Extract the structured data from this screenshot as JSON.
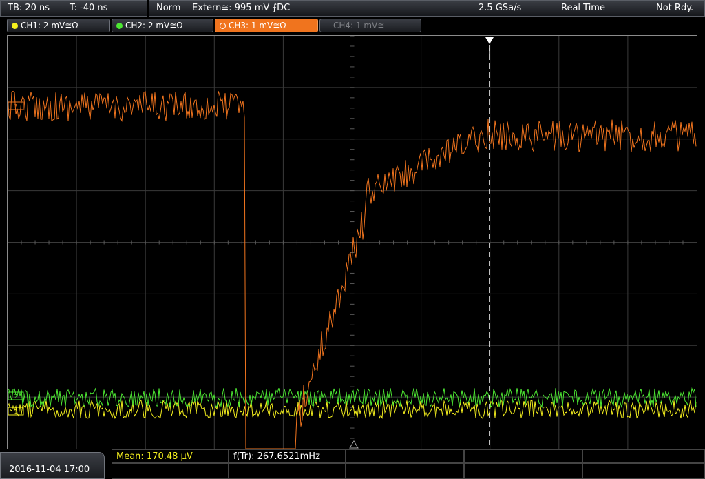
{
  "topbar": {
    "timebase": "TB: 20 ns",
    "trigger_time": "T: -40 ns",
    "trigger_mode": "Norm",
    "trigger_source": "Extern≅: 995 mV ⨍DC",
    "sample_rate": "2.5 GSa/s",
    "acq_mode": "Real Time",
    "status": "Not Rdy."
  },
  "channels": [
    {
      "label": "CH1: 2 mV≅Ω",
      "color": "#f5f01e"
    },
    {
      "label": "CH2: 2 mV≅Ω",
      "color": "#4ce632"
    },
    {
      "label": "CH3: 1 mV≅Ω",
      "color": "#f0741e"
    },
    {
      "label": "CH4: 1 mV≅",
      "color": "#7d7f84"
    }
  ],
  "trigger_marker": "T",
  "markers": {
    "ch3": "3",
    "ch2": "2",
    "ch1": "1"
  },
  "measurements": {
    "mean": "Mean: 170.48 µV",
    "freq": "f(Tr): 267.6521mHz"
  },
  "datetime": "2016-11-04 17:00"
}
